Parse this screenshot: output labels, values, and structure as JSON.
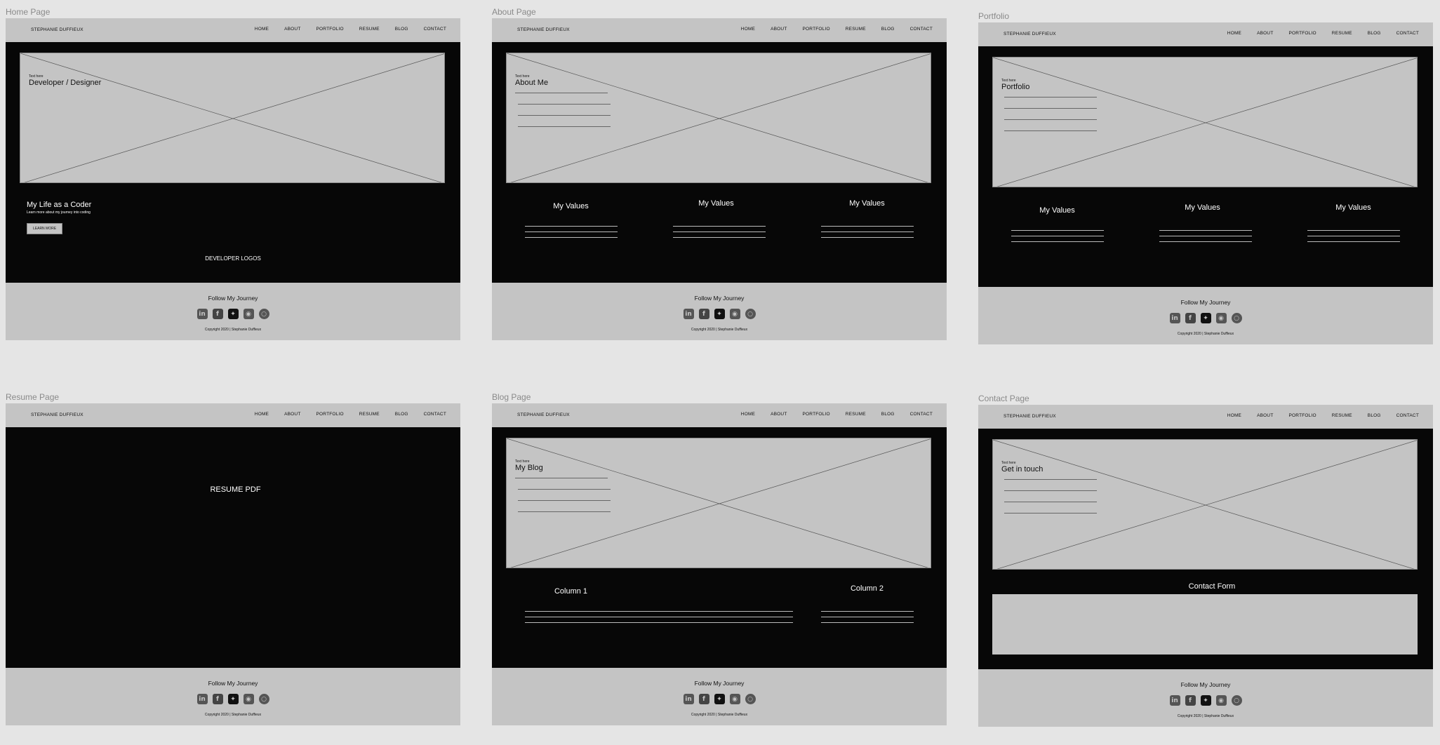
{
  "brand": "STEPHANIE DUFFIEUX",
  "nav": [
    "HOME",
    "ABOUT",
    "PORTFOLIO",
    "RESUME",
    "BLOG",
    "CONTACT"
  ],
  "footer": {
    "follow": "Follow My Journey",
    "copyright": "Copyright 2020 | Stephanie Duffieux",
    "icons": [
      "linkedin-icon",
      "facebook-icon",
      "twitter-icon",
      "github-icon",
      "instagram-icon"
    ]
  },
  "home": {
    "frame_title": "Home Page",
    "hero_small": "Text here",
    "hero_title": "Developer / Designer",
    "section_title": "My Life as a Coder",
    "section_sub": "Learn more about my journey into coding",
    "button": "LEARN MORE",
    "logos": "DEVELOPER LOGOS"
  },
  "about": {
    "frame_title": "About Page",
    "hero_small": "Text here",
    "hero_title": "About Me",
    "values": [
      "My Values",
      "My Values",
      "My Values"
    ]
  },
  "portfolio": {
    "frame_title": "Portfolio",
    "hero_small": "Text here",
    "hero_title": "Portfolio",
    "values": [
      "My Values",
      "My Values",
      "My Values"
    ]
  },
  "resume": {
    "frame_title": "Resume Page",
    "title": "RESUME PDF"
  },
  "blog": {
    "frame_title": "Blog Page",
    "hero_small": "Text here",
    "hero_title": "My Blog",
    "col1": "Column 1",
    "col2": "Column 2"
  },
  "contact": {
    "frame_title": "Contact Page",
    "hero_small": "Text here",
    "hero_title": "Get in touch",
    "form_title": "Contact Form"
  }
}
